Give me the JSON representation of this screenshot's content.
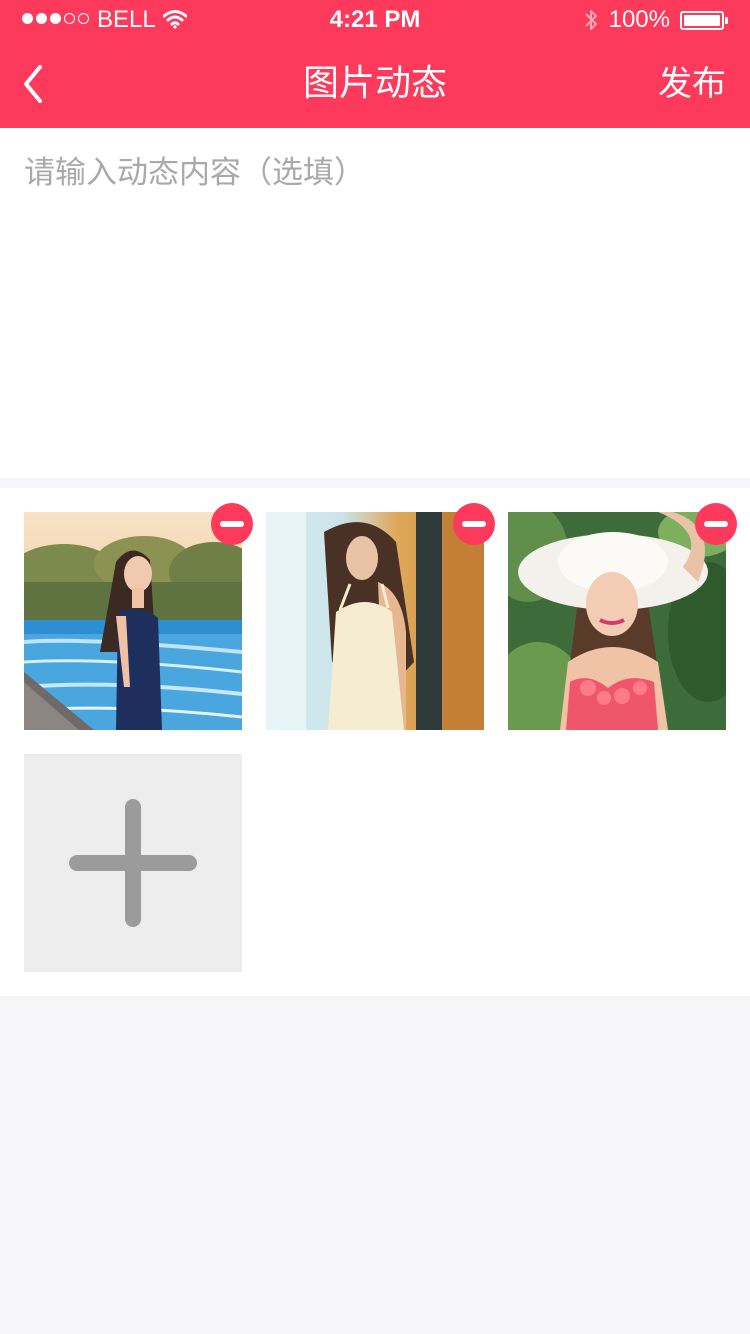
{
  "status_bar": {
    "carrier": "BELL",
    "time": "4:21 PM",
    "battery_percent": "100%",
    "signal_filled": 3,
    "signal_total": 5
  },
  "nav": {
    "title": "图片动态",
    "publish_label": "发布",
    "back_icon": "chevron-left-icon"
  },
  "post": {
    "content_value": "",
    "content_placeholder": "请输入动态内容（选填）"
  },
  "images": {
    "items": [
      {
        "subject": "woman-by-pool-photo"
      },
      {
        "subject": "woman-in-white-dress-photo"
      },
      {
        "subject": "woman-in-sun-hat-photo"
      }
    ],
    "remove_icon": "minus-circle-icon",
    "add_icon": "plus-icon"
  },
  "colors": {
    "accent": "#fd3a5b",
    "page_background": "#f6f6f9",
    "placeholder_text": "#a9a9a9",
    "add_tile": "#ededed",
    "add_glyph": "#9b9b9b"
  }
}
